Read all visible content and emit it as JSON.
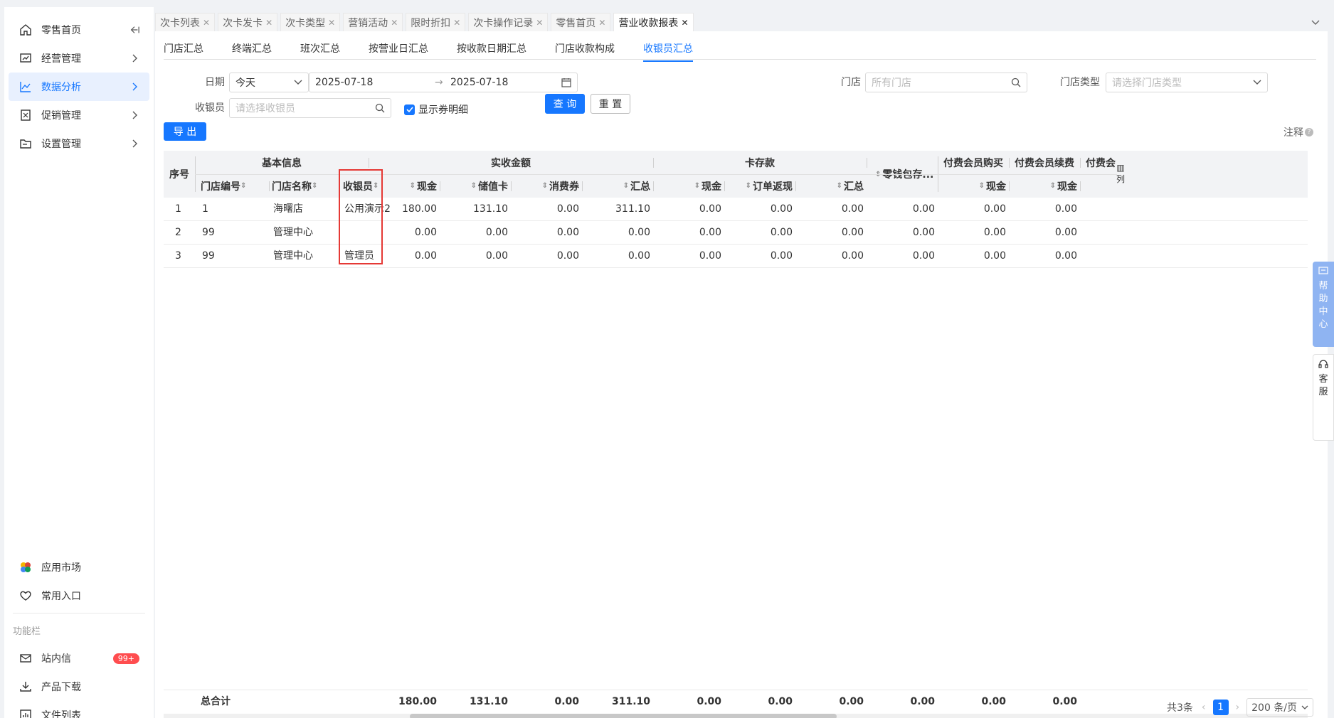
{
  "sidebar": {
    "items": [
      {
        "label": "零售首页",
        "icon": "home-icon"
      },
      {
        "label": "经营管理",
        "icon": "chart-board-icon"
      },
      {
        "label": "数据分析",
        "icon": "line-chart-icon"
      },
      {
        "label": "促销管理",
        "icon": "coupon-icon"
      },
      {
        "label": "设置管理",
        "icon": "folder-icon"
      }
    ],
    "bottom": {
      "app_market": "应用市场",
      "common_entry": "常用入口",
      "section_title": "功能栏",
      "messages": "站内信",
      "messages_badge": "99+",
      "download": "产品下载",
      "files": "文件列表"
    }
  },
  "tabs": [
    {
      "label": "次卡列表"
    },
    {
      "label": "次卡发卡"
    },
    {
      "label": "次卡类型"
    },
    {
      "label": "营销活动"
    },
    {
      "label": "限时折扣"
    },
    {
      "label": "次卡操作记录"
    },
    {
      "label": "零售首页"
    },
    {
      "label": "营业收款报表",
      "active": true
    }
  ],
  "subtabs": [
    "门店汇总",
    "终端汇总",
    "班次汇总",
    "按营业日汇总",
    "按收款日期汇总",
    "门店收款构成",
    "收银员汇总"
  ],
  "filters": {
    "date_label": "日期",
    "date_preset": "今天",
    "date_start": "2025-07-18",
    "date_arrow": "→",
    "date_end": "2025-07-18",
    "store_label": "门店",
    "store_placeholder": "所有门店",
    "store_type_label": "门店类型",
    "store_type_placeholder": "请选择门店类型",
    "cashier_label": "收银员",
    "cashier_placeholder": "请选择收银员",
    "show_coupon_detail": "显示券明细",
    "query": "查 询",
    "reset": "重 置",
    "export": "导 出",
    "notes": "注释"
  },
  "table": {
    "group_headers": {
      "seq": "序号",
      "basic": "基本信息",
      "received": "实收金额",
      "card_deposit": "卡存款",
      "change_wallet": "零钱包存...",
      "member_buy": "付费会员购买",
      "member_renew": "付费会员续费",
      "member_more": "付费会",
      "columns_btn": "列"
    },
    "columns": {
      "store_no": "门店编号",
      "store_name": "门店名称",
      "cashier": "收银员",
      "cash": "现金",
      "stored_card": "储值卡",
      "coupon": "消费券",
      "total": "汇总",
      "card_cash": "现金",
      "order_refund": "订单返现",
      "card_total": "汇总",
      "member_buy_cash": "现金",
      "member_renew_cash": "现金"
    },
    "rows": [
      {
        "seq": "1",
        "store_no": "1",
        "store_name": "海曙店",
        "cashier": "公用演示2",
        "cash": "180.00",
        "stored_card": "131.10",
        "coupon": "0.00",
        "total": "311.10",
        "card_cash": "0.00",
        "order_refund": "0.00",
        "card_total": "0.00",
        "change_wallet": "0.00",
        "member_buy_cash": "0.00",
        "member_renew_cash": "0.00"
      },
      {
        "seq": "2",
        "store_no": "99",
        "store_name": "管理中心",
        "cashier": "",
        "cash": "0.00",
        "stored_card": "0.00",
        "coupon": "0.00",
        "total": "0.00",
        "card_cash": "0.00",
        "order_refund": "0.00",
        "card_total": "0.00",
        "change_wallet": "0.00",
        "member_buy_cash": "0.00",
        "member_renew_cash": "0.00"
      },
      {
        "seq": "3",
        "store_no": "99",
        "store_name": "管理中心",
        "cashier": "管理员",
        "cash": "0.00",
        "stored_card": "0.00",
        "coupon": "0.00",
        "total": "0.00",
        "card_cash": "0.00",
        "order_refund": "0.00",
        "card_total": "0.00",
        "change_wallet": "0.00",
        "member_buy_cash": "0.00",
        "member_renew_cash": "0.00"
      }
    ],
    "footer": {
      "label": "总合计",
      "cash": "180.00",
      "stored_card": "131.10",
      "coupon": "0.00",
      "total": "311.10",
      "card_cash": "0.00",
      "order_refund": "0.00",
      "card_total": "0.00",
      "change_wallet": "0.00",
      "member_buy_cash": "0.00",
      "member_renew_cash": "0.00"
    }
  },
  "pagination": {
    "total_text": "共3条",
    "current_page": "1",
    "page_size": "200 条/页"
  },
  "floats": {
    "help": [
      "帮",
      "助",
      "中",
      "心"
    ],
    "service": [
      "客",
      "服"
    ]
  },
  "colors": {
    "primary": "#1677ff",
    "highlight_box": "#e53935",
    "badge": "#ff4d4f"
  }
}
